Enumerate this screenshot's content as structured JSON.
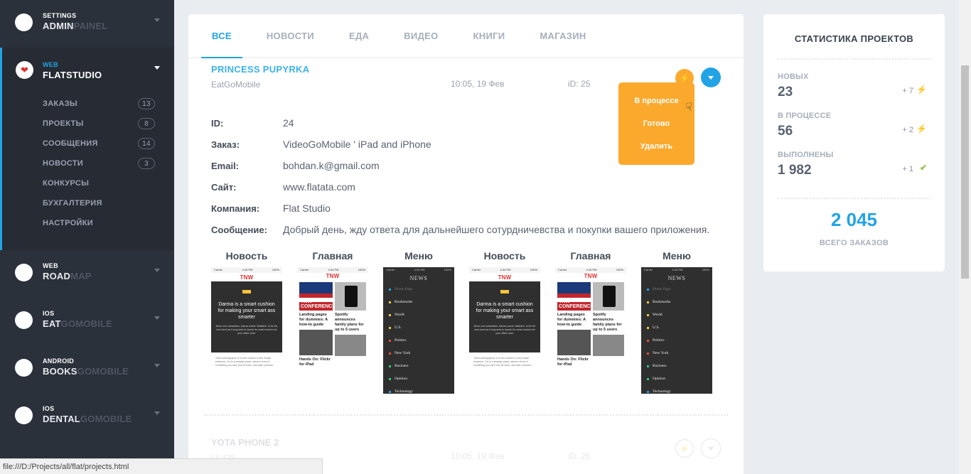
{
  "sidebar": {
    "projects": [
      {
        "platform": "SETTINGS",
        "name1": "ADMIN",
        "name2": "PAINEL"
      },
      {
        "platform": "WEB",
        "name1": "FLAT",
        "name2": "STUDIO"
      },
      {
        "platform": "WEB",
        "name1": "ROAD",
        "name2": "MAP"
      },
      {
        "platform": "IOS",
        "name1": "EAT",
        "name2": "GOMOBILE"
      },
      {
        "platform": "ANDROID",
        "name1": "BOOKS",
        "name2": "GOMOBILE"
      },
      {
        "platform": "IOS",
        "name1": "DENTAL",
        "name2": "GOMOBILE"
      }
    ],
    "submenu": [
      {
        "label": "ЗАКАЗЫ",
        "count": "13"
      },
      {
        "label": "ПРОЕКТЫ",
        "count": "8"
      },
      {
        "label": "СООБЩЕНИЯ",
        "count": "14"
      },
      {
        "label": "НОВОСТИ",
        "count": "3"
      },
      {
        "label": "КОНКУРСЫ",
        "count": ""
      },
      {
        "label": "БУХГАЛТЕРИЯ",
        "count": ""
      },
      {
        "label": "НАСТРОЙКИ",
        "count": ""
      }
    ],
    "active_icon": "heart-icon"
  },
  "tabs": [
    "ВСЕ",
    "НОВОСТИ",
    "ЕДА",
    "ВИДЕО",
    "КНИГИ",
    "МАГАЗИН"
  ],
  "project": {
    "title": "PRINCESS PUPYRKA",
    "client": "EatGoMobile",
    "date": "10:05, 19 Фев",
    "id": "iD: 25",
    "status_icon": "bolt-icon",
    "dropdown": [
      "В процессе",
      "Готово",
      "Удалить"
    ],
    "details": [
      {
        "k": "ID:",
        "v": "24"
      },
      {
        "k": "Заказ:",
        "v": "VideoGoMobile ' iPad and iPhone"
      },
      {
        "k": "Email:",
        "v": "bohdan.k@gmail.com"
      },
      {
        "k": "Сайт:",
        "v": "www.flatata.com"
      },
      {
        "k": "Компания:",
        "v": "Flat Studio"
      },
      {
        "k": "Сообщение:",
        "v": "Добрый день, жду ответа для дальнейшего сотурдничевства и покупки вашего приложения."
      }
    ],
    "screens": [
      "Новость",
      "Главная",
      "Меню",
      "Новость",
      "Главная",
      "Меню"
    ],
    "mock": {
      "carrier": "Carrier",
      "time": "4:34 PM",
      "battery": "100%",
      "logo": "TNW",
      "news_headline": "Darma is a smart cushion for making your smart ass smarter",
      "news_sub": "Move over wearables, Darma wants \"sittables\" to be the new trend as it proposes to launch its smart cushion for your office chair.",
      "news_body": "Travel photography is on the surface a very simple endeavor. Go to a faraway place, stand in front of something you can't see at home, and take a picture.",
      "main_conf": "TNW CONFERENCE",
      "main_a": "Landing pages for dummies: A how-to guide",
      "main_b": "Spotify announces family plans for up to 5 users",
      "main_c": "Hands On: Flickr for iPad",
      "menu_logo": "NEWS",
      "menu_items": [
        "Home Page",
        "Bookmarks",
        "World",
        "U.S.",
        "Politics",
        "New York",
        "Business",
        "Opinion",
        "Technology"
      ]
    }
  },
  "project2": {
    "title": "YOTA PHONE 2",
    "client": "Ui iOS",
    "date": "10:05, 19 Фев",
    "id": "iD: 26"
  },
  "stats": {
    "title": "СТАТИСТИКА ПРОЕКТОВ",
    "rows": [
      {
        "label": "НОВЫХ",
        "value": "23",
        "delta": "+ 7",
        "icon": "bolt-icon",
        "color": "#22a3e6"
      },
      {
        "label": "В ПРОЦЕССЕ",
        "value": "56",
        "delta": "+ 2",
        "icon": "bolt-icon",
        "color": "#fba92d"
      },
      {
        "label": "ВЫПОЛНЕНЫ",
        "value": "1 982",
        "delta": "+ 1",
        "icon": "check-icon",
        "color": "#8bc34a"
      }
    ],
    "total": "2 045",
    "total_label": "ВСЕГО ЗАКАЗОВ"
  },
  "statusbar": "file:///D:/Projects/all/flat/projects.html",
  "colors": {
    "accent": "#22a3e6",
    "warning": "#fba92d",
    "sidebar": "#2b313b"
  }
}
